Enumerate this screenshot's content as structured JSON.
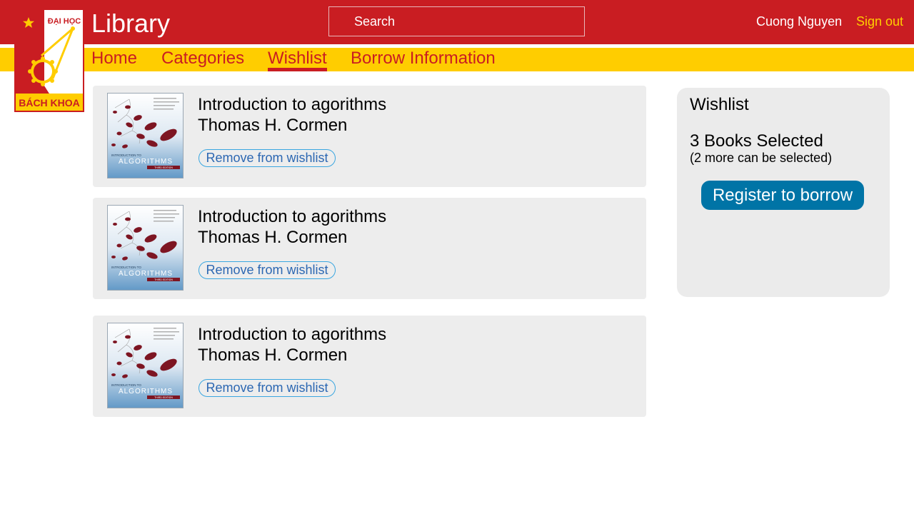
{
  "app": {
    "title": "Library"
  },
  "logo": {
    "top_text": "ĐẠI HỌC",
    "bottom_text": "BÁCH KHOA"
  },
  "search": {
    "placeholder": "Search"
  },
  "user": {
    "name": "Cuong Nguyen",
    "signout_label": "Sign out"
  },
  "nav": {
    "items": [
      {
        "label": "Home",
        "active": false
      },
      {
        "label": "Categories",
        "active": false
      },
      {
        "label": "Wishlist",
        "active": true
      },
      {
        "label": "Borrow Information",
        "active": false
      }
    ]
  },
  "wishlist": {
    "books": [
      {
        "title": "Introduction to agorithms",
        "author": "Thomas H. Cormen",
        "remove_label": "Remove from wishlist",
        "cover": {
          "series_line": "INTRODUCTION TO",
          "word": "ALGORITHMS",
          "edition": "THIRD EDITION"
        }
      },
      {
        "title": "Introduction to agorithms",
        "author": "Thomas H. Cormen",
        "remove_label": "Remove from wishlist",
        "cover": {
          "series_line": "INTRODUCTION TO",
          "word": "ALGORITHMS",
          "edition": "THIRD EDITION"
        }
      },
      {
        "title": "Introduction to agorithms",
        "author": "Thomas H. Cormen",
        "remove_label": "Remove from wishlist",
        "cover": {
          "series_line": "INTRODUCTION TO",
          "word": "ALGORITHMS",
          "edition": "THIRD EDITION"
        }
      }
    ]
  },
  "panel": {
    "title": "Wishlist",
    "selected_text": "3 Books Selected",
    "remaining_text": "(2 more can be selected)",
    "register_label": "Register to borrow"
  },
  "colors": {
    "header_red": "#c91d22",
    "nav_yellow": "#ffcd00",
    "signout_yellow": "#ffcf00",
    "button_blue": "#0074a6",
    "remove_border": "#3aa6e0",
    "remove_text": "#2c67b2",
    "card_gray": "#ededed"
  }
}
